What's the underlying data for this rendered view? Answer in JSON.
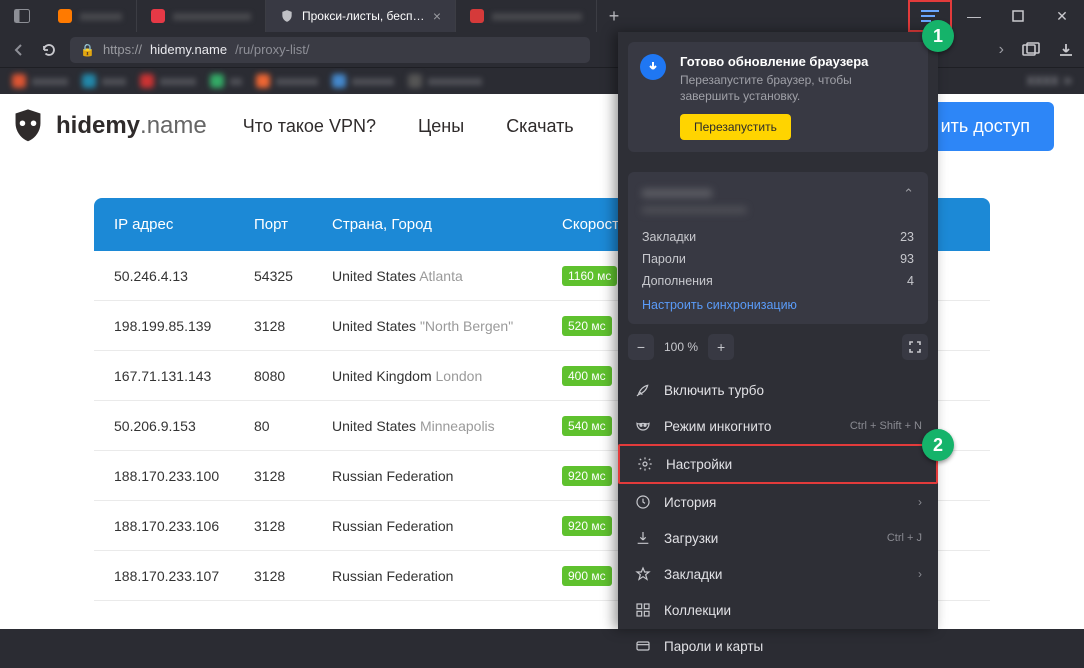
{
  "titlebar": {
    "tabs": [
      {
        "label": "",
        "active": false,
        "fav": "#ff7a00"
      },
      {
        "label": "",
        "active": false,
        "fav": "#e63946"
      },
      {
        "label": "Прокси-листы, беспла",
        "active": true,
        "fav": "#9aa0a6"
      },
      {
        "label": "",
        "active": false,
        "fav": "#d53a3a"
      }
    ]
  },
  "addressbar": {
    "scheme": "https://",
    "host": "hidemy.name",
    "path": "/ru/proxy-list/"
  },
  "page": {
    "logo_main": "hidemy",
    "logo_sub": ".name",
    "nav": [
      "Что такое VPN?",
      "Цены",
      "Скачать"
    ],
    "cta": "ить доступ",
    "table": {
      "headers": {
        "ip": "IP адрес",
        "port": "Порт",
        "loc": "Страна, Город",
        "speed": "Скорость"
      },
      "rows": [
        {
          "ip": "50.246.4.13",
          "port": "54325",
          "country": "United States",
          "city": "Atlanta",
          "speed": "1160 мс"
        },
        {
          "ip": "198.199.85.139",
          "port": "3128",
          "country": "United States",
          "city": "\"North Bergen\"",
          "speed": "520 мс"
        },
        {
          "ip": "167.71.131.143",
          "port": "8080",
          "country": "United Kingdom",
          "city": "London",
          "speed": "400 мс"
        },
        {
          "ip": "50.206.9.153",
          "port": "80",
          "country": "United States",
          "city": "Minneapolis",
          "speed": "540 мс"
        },
        {
          "ip": "188.170.233.100",
          "port": "3128",
          "country": "Russian Federation",
          "city": "",
          "speed": "920 мс"
        },
        {
          "ip": "188.170.233.106",
          "port": "3128",
          "country": "Russian Federation",
          "city": "",
          "speed": "920 мс"
        },
        {
          "ip": "188.170.233.107",
          "port": "3128",
          "country": "Russian Federation",
          "city": "",
          "speed": "900 мс"
        }
      ]
    }
  },
  "panel": {
    "update": {
      "title": "Готово обновление браузера",
      "sub": "Перезапустите браузер, чтобы завершить установку.",
      "button": "Перезапустить"
    },
    "account": {
      "rows": [
        {
          "label": "Закладки",
          "value": "23"
        },
        {
          "label": "Пароли",
          "value": "93"
        },
        {
          "label": "Дополнения",
          "value": "4"
        }
      ],
      "sync": "Настроить синхронизацию"
    },
    "zoom": "100 %",
    "items": [
      {
        "icon": "rocket",
        "label": "Включить турбо"
      },
      {
        "icon": "mask",
        "label": "Режим инкогнито",
        "shortcut": "Ctrl + Shift + N"
      },
      {
        "icon": "gear",
        "label": "Настройки",
        "hl": true
      },
      {
        "icon": "clock",
        "label": "История",
        "chev": true
      },
      {
        "icon": "download",
        "label": "Загрузки",
        "shortcut": "Ctrl + J"
      },
      {
        "icon": "star",
        "label": "Закладки",
        "chev": true
      },
      {
        "icon": "grid",
        "label": "Коллекции"
      },
      {
        "icon": "card",
        "label": "Пароли и карты"
      }
    ]
  },
  "badges": {
    "b1": "1",
    "b2": "2"
  }
}
